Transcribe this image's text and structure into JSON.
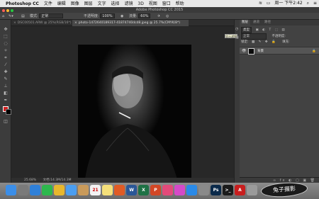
{
  "menubar": {
    "app_name": "Photoshop CC",
    "menus": [
      "文件",
      "编辑",
      "图像",
      "图层",
      "文字",
      "选择",
      "滤镜",
      "3D",
      "视图",
      "窗口",
      "帮助"
    ],
    "clock": "周一 下午2:42"
  },
  "window": {
    "title": "Adobe Photoshop CC 2015"
  },
  "options_bar": {
    "mode_label": "模式:",
    "mode_value": "正常",
    "opacity_label": "不透明度:",
    "opacity_value": "100%",
    "flow_label": "流量:",
    "flow_value": "60%"
  },
  "tabs": [
    {
      "label": "DSC00501.ARW @ 25%(RGB/16*)",
      "active": false
    },
    {
      "label": "photo-1472640189317-41874740dcd8.jpeg @ 25.7%(CMYK/8*)",
      "active": true
    }
  ],
  "status": {
    "zoom": "25.68%",
    "doc": "文档:14.3M/14.3M"
  },
  "layers_panel": {
    "tabs": [
      "图层",
      "通道",
      "路径"
    ],
    "kind_label": "类型",
    "blend_mode": "正常",
    "opacity_label": "不透明度:",
    "lock_label": "锁定:",
    "fill_label": "填充:",
    "tooltip": "显示滤镜",
    "layer_name": "背景"
  },
  "dock": {
    "apps": [
      {
        "name": "finder",
        "color": "#3b8ee8"
      },
      {
        "name": "launchpad",
        "color": "#7a7a7a"
      },
      {
        "name": "safari",
        "color": "#2f80d8"
      },
      {
        "name": "wechat",
        "color": "#2db84d"
      },
      {
        "name": "chrome",
        "color": "#e8b72d"
      },
      {
        "name": "mail",
        "color": "#4b9ef0"
      },
      {
        "name": "contacts",
        "color": "#c99a5a"
      },
      {
        "name": "calendar",
        "color": "#f2f2f2"
      },
      {
        "name": "notes",
        "color": "#f5e07a"
      },
      {
        "name": "office",
        "color": "#e05b25"
      },
      {
        "name": "word",
        "color": "#2b5797"
      },
      {
        "name": "excel",
        "color": "#1e7145"
      },
      {
        "name": "powerpoint",
        "color": "#d24726"
      },
      {
        "name": "photos",
        "color": "#e34a7a"
      },
      {
        "name": "itunes",
        "color": "#d54ac8"
      },
      {
        "name": "appstore",
        "color": "#2a8ae8"
      },
      {
        "name": "preferences",
        "color": "#8a8a8a"
      },
      {
        "name": "photoshop",
        "color": "#0b2a4a"
      },
      {
        "name": "terminal",
        "color": "#1b1b1b"
      },
      {
        "name": "acrobat",
        "color": "#c81e1e"
      },
      {
        "name": "trash",
        "color": "#9a9a9a"
      }
    ],
    "calendar_day": "21"
  },
  "watermark": "兔子摄影",
  "colors": {
    "foreground": "#d01f1f",
    "background": "#000000"
  }
}
